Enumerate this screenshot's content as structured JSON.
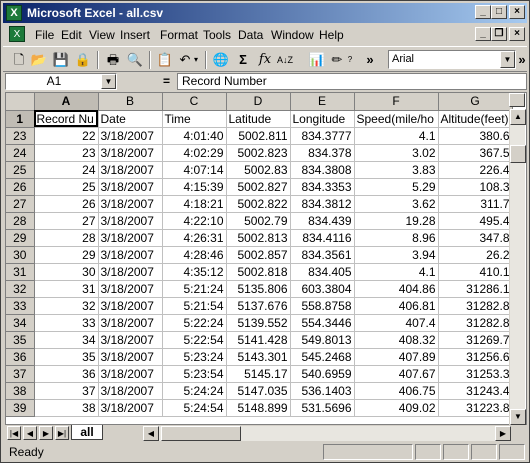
{
  "window": {
    "title": "Microsoft Excel - all.csv"
  },
  "menu": {
    "items": [
      "File",
      "Edit",
      "View",
      "Insert",
      "Format",
      "Tools",
      "Data",
      "Window",
      "Help"
    ]
  },
  "toolbar": {
    "font_name": "Arial",
    "overflow": "»"
  },
  "formula_bar": {
    "cell_ref": "A1",
    "equals": "=",
    "content": "Record Number"
  },
  "grid": {
    "columns": [
      "A",
      "B",
      "C",
      "D",
      "E",
      "F",
      "G"
    ],
    "header_row": {
      "row_num": "1",
      "cells": [
        "Record Nu",
        "Date",
        "Time",
        "Latitude",
        "Longitude",
        "Speed(mile/ho",
        "Altitude(feet)"
      ]
    },
    "rows": [
      {
        "row_num": "23",
        "cells": [
          "22",
          "3/18/2007",
          "4:01:40",
          "5002.811",
          "834.3777",
          "4.1",
          "380.6"
        ]
      },
      {
        "row_num": "24",
        "cells": [
          "23",
          "3/18/2007",
          "4:02:29",
          "5002.823",
          "834.378",
          "3.02",
          "367.5"
        ]
      },
      {
        "row_num": "25",
        "cells": [
          "24",
          "3/18/2007",
          "4:07:14",
          "5002.83",
          "834.3808",
          "3.83",
          "226.4"
        ]
      },
      {
        "row_num": "26",
        "cells": [
          "25",
          "3/18/2007",
          "4:15:39",
          "5002.827",
          "834.3353",
          "5.29",
          "108.3"
        ]
      },
      {
        "row_num": "27",
        "cells": [
          "26",
          "3/18/2007",
          "4:18:21",
          "5002.822",
          "834.3812",
          "3.62",
          "311.7"
        ]
      },
      {
        "row_num": "28",
        "cells": [
          "27",
          "3/18/2007",
          "4:22:10",
          "5002.79",
          "834.439",
          "19.28",
          "495.4"
        ]
      },
      {
        "row_num": "29",
        "cells": [
          "28",
          "3/18/2007",
          "4:26:31",
          "5002.813",
          "834.4116",
          "8.96",
          "347.8"
        ]
      },
      {
        "row_num": "30",
        "cells": [
          "29",
          "3/18/2007",
          "4:28:46",
          "5002.857",
          "834.3561",
          "3.94",
          "26.2"
        ]
      },
      {
        "row_num": "31",
        "cells": [
          "30",
          "3/18/2007",
          "4:35:12",
          "5002.818",
          "834.405",
          "4.1",
          "410.1"
        ]
      },
      {
        "row_num": "32",
        "cells": [
          "31",
          "3/18/2007",
          "5:21:24",
          "5135.806",
          "603.3804",
          "404.86",
          "31286.1"
        ]
      },
      {
        "row_num": "33",
        "cells": [
          "32",
          "3/18/2007",
          "5:21:54",
          "5137.676",
          "558.8758",
          "406.81",
          "31282.8"
        ]
      },
      {
        "row_num": "34",
        "cells": [
          "33",
          "3/18/2007",
          "5:22:24",
          "5139.552",
          "554.3446",
          "407.4",
          "31282.8"
        ]
      },
      {
        "row_num": "35",
        "cells": [
          "34",
          "3/18/2007",
          "5:22:54",
          "5141.428",
          "549.8013",
          "408.32",
          "31269.7"
        ]
      },
      {
        "row_num": "36",
        "cells": [
          "35",
          "3/18/2007",
          "5:23:24",
          "5143.301",
          "545.2468",
          "407.89",
          "31256.6"
        ]
      },
      {
        "row_num": "37",
        "cells": [
          "36",
          "3/18/2007",
          "5:23:54",
          "5145.17",
          "540.6959",
          "407.67",
          "31253.3"
        ]
      },
      {
        "row_num": "38",
        "cells": [
          "37",
          "3/18/2007",
          "5:24:24",
          "5147.035",
          "536.1403",
          "406.75",
          "31243.4"
        ]
      },
      {
        "row_num": "39",
        "cells": [
          "38",
          "3/18/2007",
          "5:24:54",
          "5148.899",
          "531.5696",
          "409.02",
          "31223.8"
        ]
      }
    ]
  },
  "sheet_tabs": [
    "all"
  ],
  "status": {
    "text": "Ready"
  }
}
